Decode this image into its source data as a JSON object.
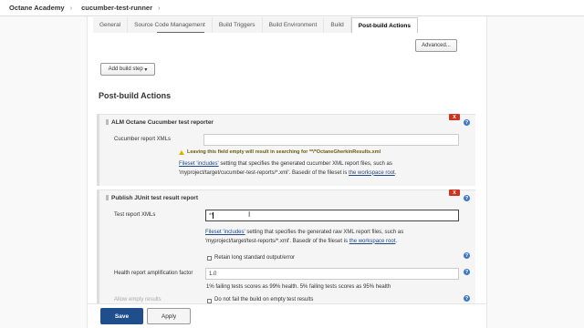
{
  "breadcrumb": {
    "items": [
      "Octane Academy",
      "cucumber-test-runner"
    ],
    "separator": "›"
  },
  "tabs": [
    "General",
    "Source Code Management",
    "Build Triggers",
    "Build Environment",
    "Build",
    "Post-build Actions"
  ],
  "active_tab": "Post-build Actions",
  "build_section": {
    "advanced_label": "Advanced...",
    "add_build_step_label": "Add build step",
    "dropdown_glyph": "▾"
  },
  "post_build_title": "Post-build Actions",
  "cucumber_reporter": {
    "title": "ALM Octane Cucumber test reporter",
    "field_label": "Cucumber report XMLs",
    "field_value": "",
    "warning": "Leaving this field empty will result in searching for **/*OctaneGherkinResults.xml",
    "desc_link1": "Fileset 'includes'",
    "desc_text1": " setting that specifies the generated cucumber XML report files, such as",
    "desc_text2": "'myproject/target/cucumber-test-reports/*.xml'. Basedir of the fileset is ",
    "desc_link2": "the workspace root",
    "desc_end": "."
  },
  "junit_reporter": {
    "title": "Publish JUnit test result report",
    "field_label": "Test report XMLs",
    "field_value": "**",
    "desc_link1": "Fileset 'includes'",
    "desc_text1": " setting that specifies the generated raw XML report files, such as",
    "desc_text2": "'myproject/target/test-reports/*.xml'. Basedir of the fileset is ",
    "desc_link2": "the workspace root",
    "desc_end": ".",
    "retain_label": "Retain long standard output/error",
    "health_label": "Health report amplification factor",
    "health_value": "1.0",
    "health_desc": "1% failing tests scores as 99% health. 5% failing tests scores as 95% health",
    "allow_empty_label": "Allow empty results",
    "no_fail_label": "Do not fail the build on empty test results"
  },
  "icons": {
    "close": "X",
    "help": "?"
  },
  "footer": {
    "save_label": "Save",
    "apply_label": "Apply"
  },
  "colors": {
    "save_bg": "#1f4e8c",
    "delete_red": "#cc3322",
    "help_blue": "#3f78c8",
    "warning_yellow": "#e0b000"
  }
}
